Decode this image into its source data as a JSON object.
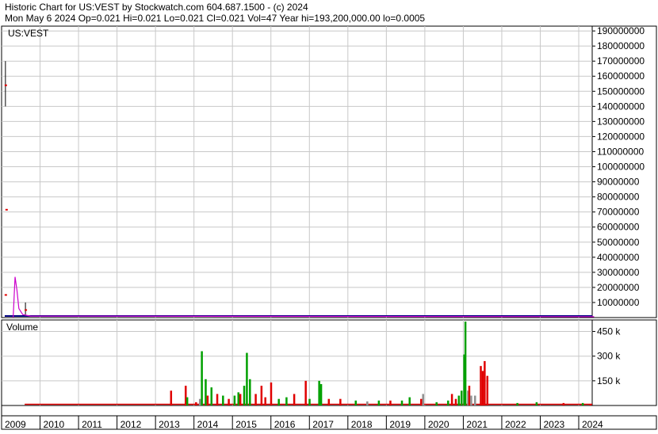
{
  "header": {
    "line1": "Historic Chart for US:VEST by Stockwatch.com 604.687.1500 - (c) 2024",
    "line2": "Mon May  6 2024   Op=0.021  Hi=0.021  Lo=0.021  Cl=0.021  Vol=47   Year hi=193,200,000.00   lo=0.0005"
  },
  "chart_data": [
    {
      "type": "line",
      "title": "US:VEST",
      "ylim": [
        0,
        193200000
      ],
      "y_ticks": [
        10000000,
        20000000,
        30000000,
        40000000,
        50000000,
        60000000,
        70000000,
        80000000,
        90000000,
        100000000,
        110000000,
        120000000,
        130000000,
        140000000,
        150000000,
        160000000,
        170000000,
        180000000,
        190000000
      ],
      "y_tick_labels": [
        "10000000",
        "20000000",
        "30000000",
        "40000000",
        "50000000",
        "60000000",
        "70000000",
        "80000000",
        "90000000",
        "100000000",
        "110000000",
        "120000000",
        "130000000",
        "140000000",
        "150000000",
        "160000000",
        "170000000",
        "180000000",
        "190000000"
      ],
      "grid": true,
      "colors": {
        "price_bar": "#000000",
        "close_marker": "#e00000",
        "moving_avg": "#cc00cc",
        "baseline": "#000080"
      },
      "price_bars": [
        {
          "x": 2009.1,
          "low": 140000000,
          "high": 170000000,
          "close": 154000000
        },
        {
          "x": 2009.12,
          "low": 71500000,
          "high": 71500000,
          "close": 71500000
        },
        {
          "x": 2009.1,
          "low": 15000000,
          "high": 15000000,
          "close": 15000000
        },
        {
          "x": 2009.62,
          "low": 2000000,
          "high": 10000000,
          "close": 5000000
        }
      ],
      "moving_average": [
        {
          "x": 2009.3,
          "y": 0
        },
        {
          "x": 2009.35,
          "y": 27000000
        },
        {
          "x": 2009.4,
          "y": 18000000
        },
        {
          "x": 2009.45,
          "y": 6000000
        },
        {
          "x": 2009.55,
          "y": 2000000
        },
        {
          "x": 2009.75,
          "y": 1000000
        },
        {
          "x": 2024.4,
          "y": 600000
        }
      ]
    },
    {
      "type": "bar",
      "title": "Volume",
      "ylim": [
        0,
        520000
      ],
      "y_ticks": [
        150000,
        300000,
        450000
      ],
      "y_tick_labels": [
        "150 k",
        "300 k",
        "450 k"
      ],
      "grid": true,
      "colors": {
        "up": "#00a000",
        "down": "#e00000",
        "flat": "#909090"
      },
      "bars": [
        {
          "x": 2013.4,
          "v": 90000,
          "c": "down"
        },
        {
          "x": 2013.78,
          "v": 120000,
          "c": "down"
        },
        {
          "x": 2013.82,
          "v": 50000,
          "c": "up"
        },
        {
          "x": 2014.05,
          "v": 20000,
          "c": "down"
        },
        {
          "x": 2014.15,
          "v": 40000,
          "c": "flat"
        },
        {
          "x": 2014.2,
          "v": 330000,
          "c": "up"
        },
        {
          "x": 2014.3,
          "v": 160000,
          "c": "up"
        },
        {
          "x": 2014.35,
          "v": 60000,
          "c": "down"
        },
        {
          "x": 2014.45,
          "v": 110000,
          "c": "up"
        },
        {
          "x": 2014.6,
          "v": 70000,
          "c": "down"
        },
        {
          "x": 2014.75,
          "v": 60000,
          "c": "up"
        },
        {
          "x": 2014.9,
          "v": 40000,
          "c": "down"
        },
        {
          "x": 2015.05,
          "v": 60000,
          "c": "up"
        },
        {
          "x": 2015.15,
          "v": 80000,
          "c": "up"
        },
        {
          "x": 2015.2,
          "v": 70000,
          "c": "down"
        },
        {
          "x": 2015.3,
          "v": 120000,
          "c": "up"
        },
        {
          "x": 2015.37,
          "v": 320000,
          "c": "up"
        },
        {
          "x": 2015.45,
          "v": 160000,
          "c": "up"
        },
        {
          "x": 2015.6,
          "v": 70000,
          "c": "down"
        },
        {
          "x": 2015.75,
          "v": 120000,
          "c": "down"
        },
        {
          "x": 2015.85,
          "v": 50000,
          "c": "down"
        },
        {
          "x": 2016.0,
          "v": 140000,
          "c": "down"
        },
        {
          "x": 2016.2,
          "v": 40000,
          "c": "up"
        },
        {
          "x": 2016.4,
          "v": 50000,
          "c": "up"
        },
        {
          "x": 2016.6,
          "v": 70000,
          "c": "down"
        },
        {
          "x": 2016.9,
          "v": 150000,
          "c": "down"
        },
        {
          "x": 2017.0,
          "v": 40000,
          "c": "up"
        },
        {
          "x": 2017.25,
          "v": 150000,
          "c": "up"
        },
        {
          "x": 2017.3,
          "v": 130000,
          "c": "up"
        },
        {
          "x": 2017.5,
          "v": 40000,
          "c": "down"
        },
        {
          "x": 2017.8,
          "v": 40000,
          "c": "down"
        },
        {
          "x": 2018.2,
          "v": 30000,
          "c": "up"
        },
        {
          "x": 2018.5,
          "v": 25000,
          "c": "flat"
        },
        {
          "x": 2018.8,
          "v": 30000,
          "c": "up"
        },
        {
          "x": 2019.1,
          "v": 30000,
          "c": "down"
        },
        {
          "x": 2019.4,
          "v": 30000,
          "c": "up"
        },
        {
          "x": 2019.6,
          "v": 50000,
          "c": "up"
        },
        {
          "x": 2019.9,
          "v": 40000,
          "c": "down"
        },
        {
          "x": 2019.95,
          "v": 70000,
          "c": "flat"
        },
        {
          "x": 2020.3,
          "v": 20000,
          "c": "up"
        },
        {
          "x": 2020.6,
          "v": 30000,
          "c": "up"
        },
        {
          "x": 2020.7,
          "v": 70000,
          "c": "down"
        },
        {
          "x": 2020.8,
          "v": 40000,
          "c": "down"
        },
        {
          "x": 2020.88,
          "v": 60000,
          "c": "up"
        },
        {
          "x": 2020.95,
          "v": 90000,
          "c": "up"
        },
        {
          "x": 2021.02,
          "v": 310000,
          "c": "up"
        },
        {
          "x": 2021.05,
          "v": 510000,
          "c": "up"
        },
        {
          "x": 2021.12,
          "v": 90000,
          "c": "flat"
        },
        {
          "x": 2021.15,
          "v": 120000,
          "c": "down"
        },
        {
          "x": 2021.2,
          "v": 60000,
          "c": "flat"
        },
        {
          "x": 2021.3,
          "v": 60000,
          "c": "flat"
        },
        {
          "x": 2021.45,
          "v": 240000,
          "c": "down"
        },
        {
          "x": 2021.5,
          "v": 210000,
          "c": "down"
        },
        {
          "x": 2021.55,
          "v": 270000,
          "c": "down"
        },
        {
          "x": 2021.62,
          "v": 180000,
          "c": "down"
        },
        {
          "x": 2022.4,
          "v": 15000,
          "c": "up"
        },
        {
          "x": 2022.9,
          "v": 20000,
          "c": "up"
        },
        {
          "x": 2023.6,
          "v": 15000,
          "c": "down"
        },
        {
          "x": 2024.1,
          "v": 15000,
          "c": "up"
        },
        {
          "x": 2024.3,
          "v": 10000,
          "c": "down"
        }
      ]
    }
  ],
  "x_axis": {
    "xlim": [
      2009,
      2024.35
    ],
    "years": [
      2009,
      2010,
      2011,
      2012,
      2013,
      2014,
      2015,
      2016,
      2017,
      2018,
      2019,
      2020,
      2021,
      2022,
      2023,
      2024
    ],
    "labels": [
      "2009",
      "2010",
      "2011",
      "2012",
      "2013",
      "2014",
      "2015",
      "2016",
      "2017",
      "2018",
      "2019",
      "2020",
      "2021",
      "2022",
      "2023",
      "2024"
    ]
  }
}
